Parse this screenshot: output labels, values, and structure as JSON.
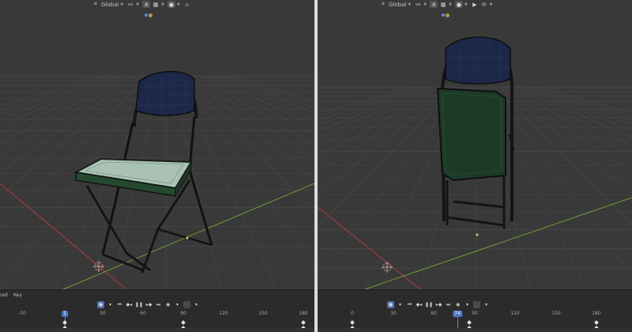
{
  "left": {
    "header": {
      "orientation_label": "Global"
    },
    "timeline": {
      "menu_items": [
        "red",
        "Key"
      ],
      "ruler_ticks": [
        "-30",
        "1",
        "30",
        "60",
        "90",
        "120",
        "150",
        "180"
      ],
      "current_frame": "1"
    }
  },
  "right": {
    "header": {
      "orientation_label": "Global"
    },
    "timeline": {
      "ruler_ticks": [
        "0",
        "30",
        "60",
        "90",
        "120",
        "150",
        "180"
      ],
      "current_frame": "74"
    }
  },
  "colors": {
    "viewport_bg": "#393939",
    "grid": "#454545",
    "x_axis": "#b43c3c",
    "y_axis": "#6f9b3a",
    "accent_blue": "#4d77c2",
    "chair_frame": "#151515",
    "seat_fabric": "#1c2848",
    "panel_green": "#1d3a28"
  },
  "icons": {
    "orientation": "orientation-icon",
    "snap": "snap-magnet-icon",
    "proportional": "proportional-edit-icon",
    "play": "play-icon",
    "record": "record-icon",
    "jump_start": "jump-start-icon",
    "prev_key": "prev-keyframe-icon",
    "pause": "pause-icon",
    "next_key": "next-keyframe-icon",
    "jump_end": "jump-end-icon",
    "keying": "keying-set-icon",
    "gizmo": "viewport-gizmo-icon",
    "cursor": "3d-cursor-icon"
  }
}
